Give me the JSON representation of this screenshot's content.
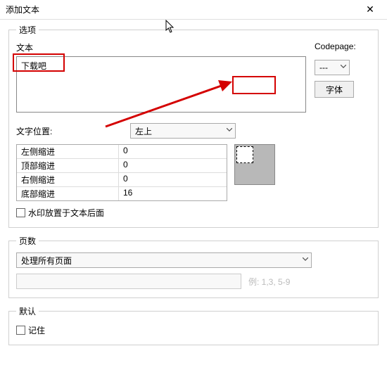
{
  "titlebar": {
    "title": "添加文本"
  },
  "group_options": {
    "legend": "选项",
    "text_label": "文本",
    "text_value": "下载吧",
    "codepage_label": "Codepage:",
    "codepage_value": "---",
    "font_button": "字体",
    "position_label": "文字位置:",
    "position_value": "左上",
    "indents": [
      {
        "label": "左侧缩进",
        "value": "0"
      },
      {
        "label": "顶部缩进",
        "value": "0"
      },
      {
        "label": "右侧缩进",
        "value": "0"
      },
      {
        "label": "底部缩进",
        "value": "16"
      }
    ],
    "watermark_behind": "水印放置于文本后面"
  },
  "group_pages": {
    "legend": "页数",
    "mode": "处理所有页面",
    "hint": "例: 1,3, 5-9"
  },
  "group_default": {
    "legend": "默认",
    "remember": "记住"
  }
}
